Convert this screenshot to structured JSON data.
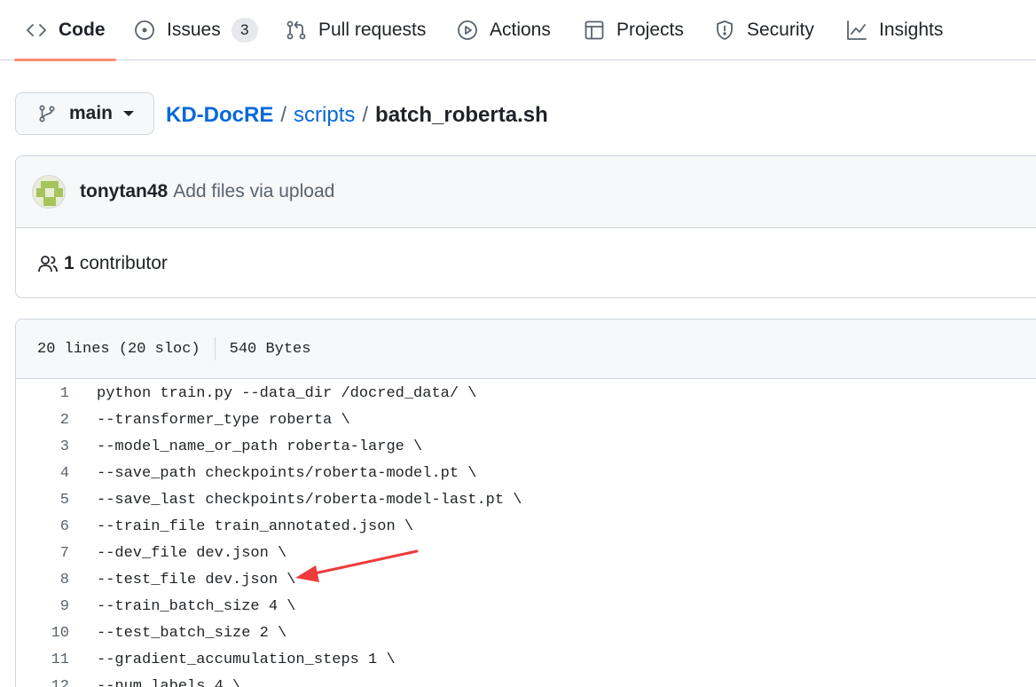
{
  "nav": {
    "tabs": [
      {
        "label": "Code",
        "icon": "code-icon"
      },
      {
        "label": "Issues",
        "icon": "issue-opened-icon",
        "count": "3"
      },
      {
        "label": "Pull requests",
        "icon": "git-pull-request-icon"
      },
      {
        "label": "Actions",
        "icon": "play-icon"
      },
      {
        "label": "Projects",
        "icon": "table-icon"
      },
      {
        "label": "Security",
        "icon": "shield-icon"
      },
      {
        "label": "Insights",
        "icon": "graph-icon"
      }
    ],
    "active_tab": "Code",
    "accent_color": "#fd8c73"
  },
  "branch": {
    "name": "main"
  },
  "breadcrumb": {
    "repo": "KD-DocRE",
    "folder": "scripts",
    "separator": "/",
    "file": "batch_roberta.sh"
  },
  "commit": {
    "author": "tonytan48",
    "message": "Add files via upload"
  },
  "contributors": {
    "count": "1",
    "label": "contributor"
  },
  "file_info": {
    "lines": "20 lines (20 sloc)",
    "size": "540 Bytes"
  },
  "code_lines": [
    {
      "n": "1",
      "text": "python train.py --data_dir /docred_data/ \\"
    },
    {
      "n": "2",
      "text": "--transformer_type roberta \\"
    },
    {
      "n": "3",
      "text": "--model_name_or_path roberta-large \\"
    },
    {
      "n": "4",
      "text": "--save_path checkpoints/roberta-model.pt \\"
    },
    {
      "n": "5",
      "text": "--save_last checkpoints/roberta-model-last.pt \\"
    },
    {
      "n": "6",
      "text": "--train_file train_annotated.json \\"
    },
    {
      "n": "7",
      "text": "--dev_file dev.json \\"
    },
    {
      "n": "8",
      "text": "--test_file dev.json \\"
    },
    {
      "n": "9",
      "text": "--train_batch_size 4 \\"
    },
    {
      "n": "10",
      "text": "--test_batch_size 2 \\"
    },
    {
      "n": "11",
      "text": "--gradient_accumulation_steps 1 \\"
    },
    {
      "n": "12",
      "text": "--num_labels 4 \\"
    }
  ],
  "annotation": {
    "color": "#ee3b3b",
    "points_to_line": "8"
  }
}
